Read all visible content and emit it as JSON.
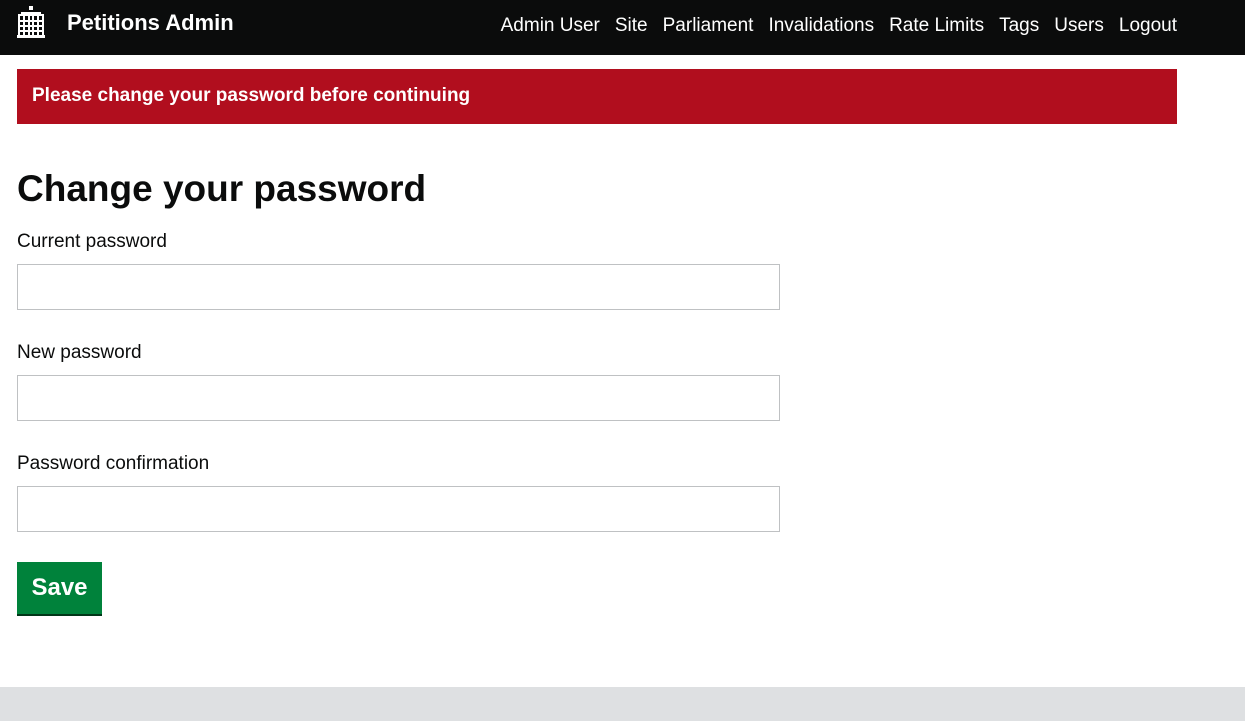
{
  "header": {
    "title": "Petitions Admin",
    "logo_icon": "portcullis-icon",
    "nav": [
      {
        "label": "Admin User"
      },
      {
        "label": "Site"
      },
      {
        "label": "Parliament"
      },
      {
        "label": "Invalidations"
      },
      {
        "label": "Rate Limits"
      },
      {
        "label": "Tags"
      },
      {
        "label": "Users"
      },
      {
        "label": "Logout"
      }
    ]
  },
  "flash": {
    "message": "Please change your password before continuing",
    "color": "#b10e1e"
  },
  "main": {
    "title": "Change your password",
    "fields": [
      {
        "label": "Current password",
        "value": ""
      },
      {
        "label": "New password",
        "value": ""
      },
      {
        "label": "Password confirmation",
        "value": ""
      }
    ],
    "save_label": "Save",
    "save_color": "#00823b"
  }
}
